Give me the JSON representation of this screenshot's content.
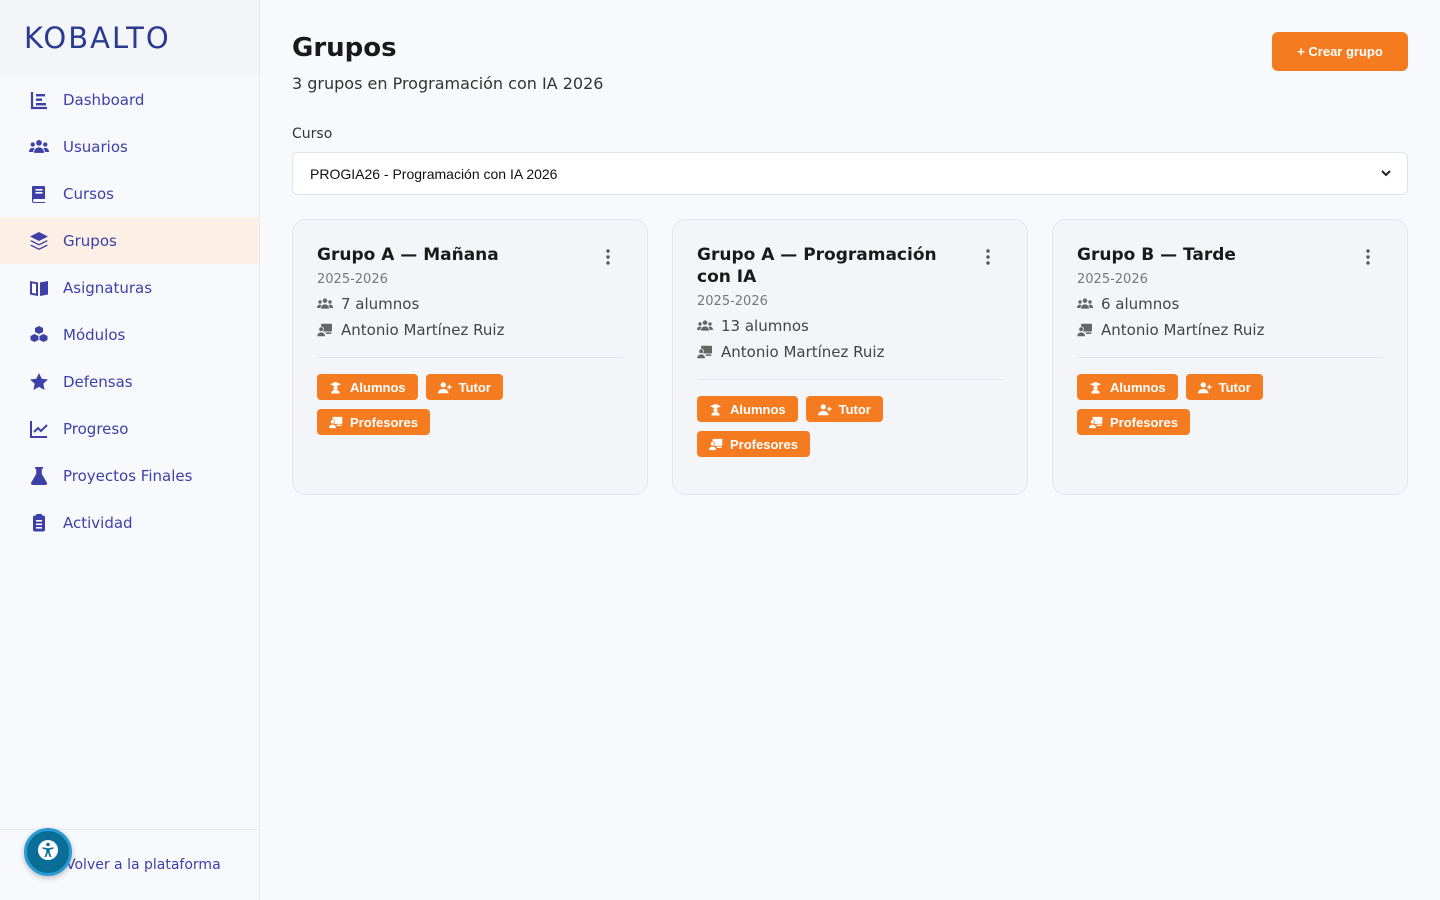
{
  "app": {
    "logo": "KOBALTO"
  },
  "sidebar": {
    "items": [
      {
        "label": "Dashboard",
        "icon": "dashboard-icon",
        "active": false
      },
      {
        "label": "Usuarios",
        "icon": "users-icon",
        "active": false
      },
      {
        "label": "Cursos",
        "icon": "book-icon",
        "active": false
      },
      {
        "label": "Grupos",
        "icon": "layers-icon",
        "active": true
      },
      {
        "label": "Asignaturas",
        "icon": "open-book-icon",
        "active": false
      },
      {
        "label": "Módulos",
        "icon": "cubes-icon",
        "active": false
      },
      {
        "label": "Defensas",
        "icon": "star-icon",
        "active": false
      },
      {
        "label": "Progreso",
        "icon": "line-chart-icon",
        "active": false
      },
      {
        "label": "Proyectos Finales",
        "icon": "flask-icon",
        "active": false
      },
      {
        "label": "Actividad",
        "icon": "clipboard-icon",
        "active": false
      }
    ],
    "footer_label": "Volver a la plataforma"
  },
  "header": {
    "title": "Grupos",
    "subtitle": "3 grupos en Programación con IA 2026",
    "create_label": "+ Crear grupo"
  },
  "filter": {
    "label": "Curso",
    "selected": "PROGIA26 - Programación con IA 2026"
  },
  "groups": [
    {
      "title": "Grupo A — Mañana",
      "year": "2025-2026",
      "students": "7 alumnos",
      "teacher": "Antonio Martínez Ruiz"
    },
    {
      "title": "Grupo A — Programación con IA",
      "year": "2025-2026",
      "students": "13 alumnos",
      "teacher": "Antonio Martínez Ruiz"
    },
    {
      "title": "Grupo B — Tarde",
      "year": "2025-2026",
      "students": "6 alumnos",
      "teacher": "Antonio Martínez Ruiz"
    }
  ],
  "card_buttons": {
    "students": "Alumnos",
    "tutor": "Tutor",
    "teachers": "Profesores"
  },
  "colors": {
    "accent": "#f47b20",
    "nav": "#3f3fa8",
    "brand": "#2a3a8f",
    "a11y": "#0b6e99"
  }
}
